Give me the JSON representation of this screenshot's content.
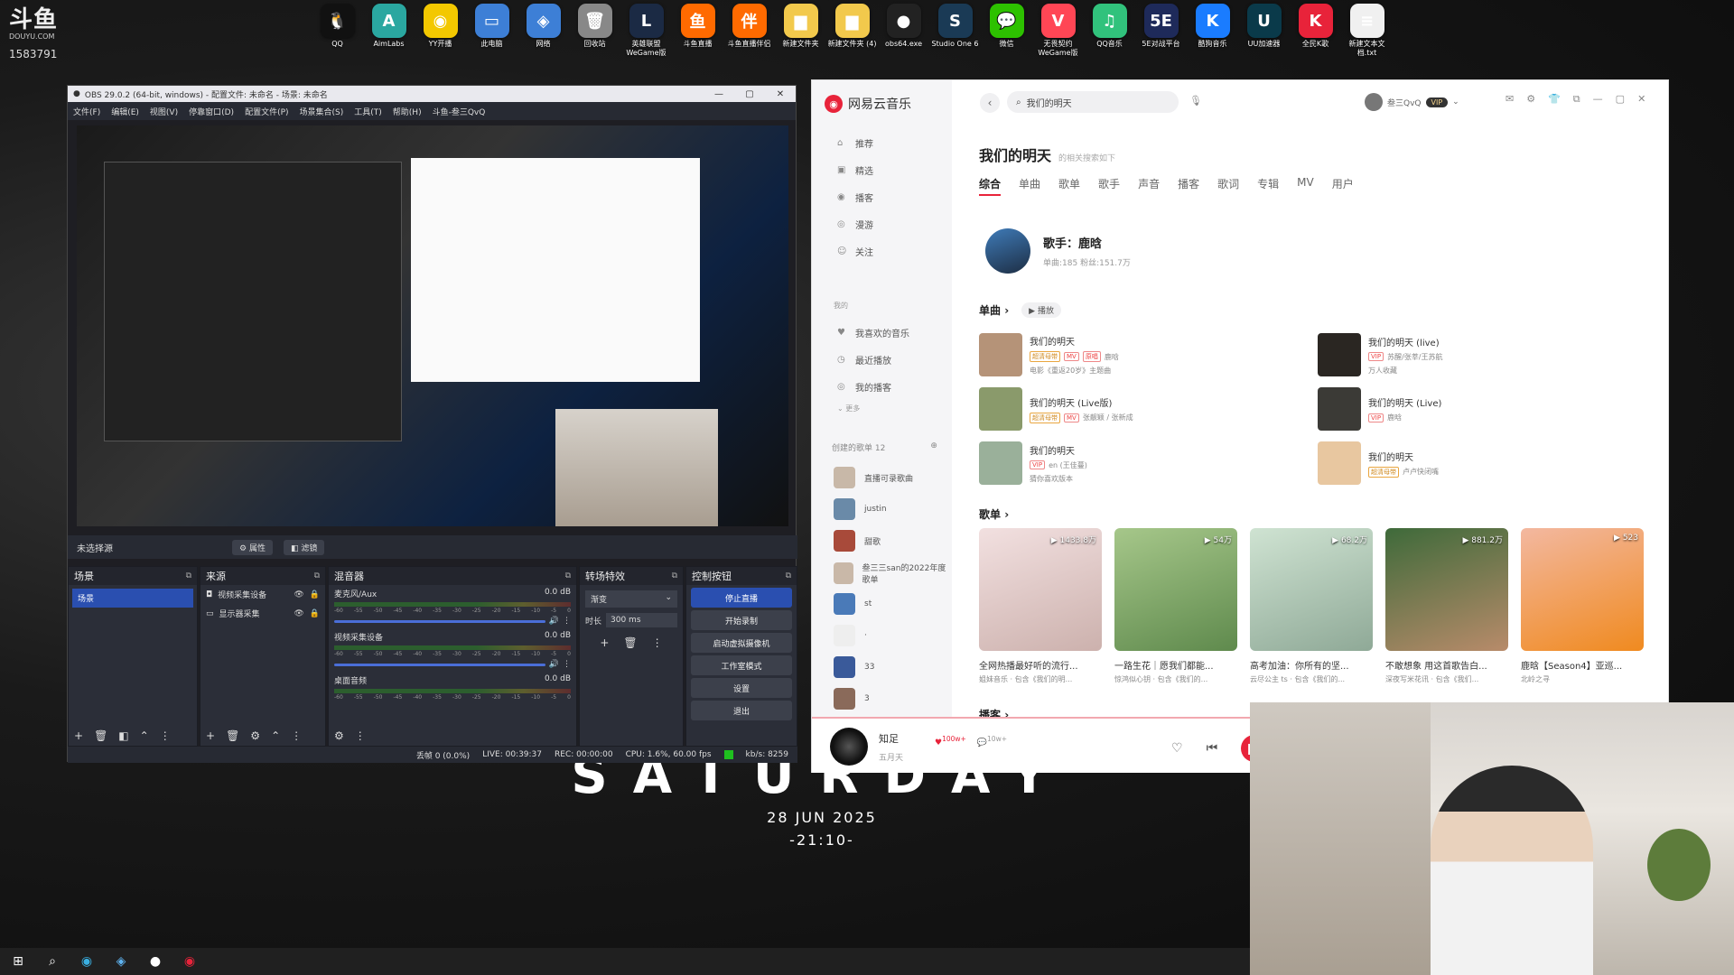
{
  "watermark": {
    "logo": "斗鱼",
    "site": "DOUYU.COM",
    "room": "1583791"
  },
  "desktop_icons": [
    {
      "label": "QQ",
      "color": "#111",
      "glyph": "🐧"
    },
    {
      "label": "AimLabs",
      "color": "#2aa7a0",
      "glyph": "A"
    },
    {
      "label": "YY开播",
      "color": "#f3c800",
      "glyph": "◉"
    },
    {
      "label": "此电脑",
      "color": "#3d7fd6",
      "glyph": "▭"
    },
    {
      "label": "网络",
      "color": "#3d7fd6",
      "glyph": "◈"
    },
    {
      "label": "回收站",
      "color": "#888",
      "glyph": "🗑"
    },
    {
      "label": "英雄联盟 WeGame版",
      "color": "#1b2a44",
      "glyph": "L"
    },
    {
      "label": "斗鱼直播",
      "color": "#ff6a00",
      "glyph": "鱼"
    },
    {
      "label": "斗鱼直播伴侣",
      "color": "#ff6a00",
      "glyph": "伴"
    },
    {
      "label": "新建文件夹",
      "color": "#f2c94c",
      "glyph": "▆"
    },
    {
      "label": "新建文件夹 (4)",
      "color": "#f2c94c",
      "glyph": "▆"
    },
    {
      "label": "obs64.exe",
      "color": "#222",
      "glyph": "●"
    },
    {
      "label": "Studio One 6",
      "color": "#1a3a55",
      "glyph": "S"
    },
    {
      "label": "微信",
      "color": "#2dc100",
      "glyph": "💬"
    },
    {
      "label": "无畏契约 WeGame版",
      "color": "#ff4655",
      "glyph": "V"
    },
    {
      "label": "QQ音乐",
      "color": "#31c27c",
      "glyph": "♫"
    },
    {
      "label": "5E对战平台",
      "color": "#1e2a5a",
      "glyph": "5E"
    },
    {
      "label": "酷狗音乐",
      "color": "#1a7cff",
      "glyph": "K"
    },
    {
      "label": "UU加速器",
      "color": "#0a3a4a",
      "glyph": "U"
    },
    {
      "label": "全民K歌",
      "color": "#e8233a",
      "glyph": "K"
    },
    {
      "label": "新建文本文档.txt",
      "color": "#f0f0f0",
      "glyph": "≡"
    }
  ],
  "wallpaper": {
    "title": "SATURDAY",
    "date": "28 JUN 2025",
    "time": "-21:10-"
  },
  "obs": {
    "title": "OBS 29.0.2 (64-bit, windows) - 配置文件: 未命名 - 场景: 未命名",
    "menu": [
      "文件(F)",
      "编辑(E)",
      "视图(V)",
      "停靠窗口(D)",
      "配置文件(P)",
      "场景集合(S)",
      "工具(T)",
      "帮助(H)",
      "斗鱼-叁三QvQ"
    ],
    "no_source": "未选择源",
    "btn_props": "属性",
    "btn_filters": "滤镜",
    "docks": {
      "scenes": "场景",
      "sources": "来源",
      "mixer": "混音器",
      "transitions": "转场特效",
      "controls": "控制按钮"
    },
    "scene_items": [
      "场景"
    ],
    "sources": [
      "视频采集设备",
      "显示器采集"
    ],
    "mixer": [
      {
        "name": "麦克风/Aux",
        "db": "0.0 dB"
      },
      {
        "name": "视频采集设备",
        "db": "0.0 dB"
      },
      {
        "name": "桌面音频",
        "db": "0.0 dB"
      }
    ],
    "mixer_ticks": [
      "-60",
      "-55",
      "-50",
      "-45",
      "-40",
      "-35",
      "-30",
      "-25",
      "-20",
      "-15",
      "-10",
      "-5",
      "0"
    ],
    "transition": {
      "type": "渐变",
      "duration_label": "时长",
      "duration": "300 ms"
    },
    "controls": [
      "停止直播",
      "开始录制",
      "启动虚拟摄像机",
      "工作室模式",
      "设置",
      "退出"
    ],
    "status": {
      "dropped": "丢帧 0 (0.0%)",
      "live": "LIVE: 00:39:37",
      "rec": "REC: 00:00:00",
      "cpu": "CPU: 1.6%, 60.00 fps",
      "kbs": "kb/s: 8259"
    }
  },
  "netease": {
    "brand": "网易云音乐",
    "search": "我们的明天",
    "user": "叁三QvQ",
    "vip": "VIP",
    "nav": [
      {
        "label": "推荐",
        "icon": "⌂"
      },
      {
        "label": "精选",
        "icon": "▣"
      },
      {
        "label": "播客",
        "icon": "◉"
      },
      {
        "label": "漫游",
        "icon": "◎"
      },
      {
        "label": "关注",
        "icon": "☺"
      }
    ],
    "my_label": "我的",
    "my": [
      {
        "label": "我喜欢的音乐",
        "icon": "♥"
      },
      {
        "label": "最近播放",
        "icon": "◷"
      },
      {
        "label": "我的播客",
        "icon": "◎"
      }
    ],
    "more": "更多",
    "created_label": "创建的歌单 12",
    "playlists": [
      {
        "label": "直播可录歌曲"
      },
      {
        "label": "justin"
      },
      {
        "label": "甜歌"
      },
      {
        "label": "叁三三san的2022年度歌单"
      },
      {
        "label": "st"
      },
      {
        "label": "·"
      },
      {
        "label": "33"
      },
      {
        "label": "3"
      }
    ],
    "result_title": "我们的明天",
    "result_hint": "的相关搜索如下",
    "tabs": [
      "综合",
      "单曲",
      "歌单",
      "歌手",
      "声音",
      "播客",
      "歌词",
      "专辑",
      "MV",
      "用户"
    ],
    "artist": {
      "label": "歌手：鹿晗",
      "meta": "单曲:185    粉丝:151.7万"
    },
    "singles_label": "单曲",
    "play_label": "播放",
    "singles": [
      {
        "title": "我们的明天",
        "tags": [
          "超清母带",
          "MV",
          "原唱"
        ],
        "sub": "鹿晗",
        "sub2": "电影《重返20岁》主题曲",
        "color": "#b59378"
      },
      {
        "title": "我们的明天 (Live版)",
        "tags": [
          "超清母带",
          "MV"
        ],
        "sub": "张靓颖 / 张新成",
        "sub2": "",
        "color": "#8a9a6b"
      },
      {
        "title": "我们的明天",
        "tags": [
          "VIP"
        ],
        "sub": "en (王佳蔓)",
        "sub2": "猜你喜欢版本",
        "color": "#9ab09a"
      },
      {
        "title": "我们的明天 (live)",
        "tags": [
          "VIP"
        ],
        "sub": "苏醒/张莘/王苏航",
        "sub2": "万人收藏",
        "color": "#2a2622"
      },
      {
        "title": "我们的明天 (Live)",
        "tags": [
          "VIP"
        ],
        "sub": "鹿晗",
        "sub2": "",
        "color": "#3b3a36"
      },
      {
        "title": "我们的明天",
        "tags": [
          "超清母带"
        ],
        "sub": "卢卢快闭嘴",
        "sub2": "",
        "color": "#e8c7a0"
      }
    ],
    "playlists_label": "歌单",
    "playlist_cards": [
      {
        "name": "全网热播最好听的流行...",
        "author": "姐妹音乐 · 包含《我们的明...",
        "count": "1433.8万",
        "c1": "#f2e0e0",
        "c2": "#ccb1ad"
      },
      {
        "name": "一路生花｜愿我们都能...",
        "author": "惊鸿似心钥 · 包含《我们的...",
        "count": "54万",
        "c1": "#a6c78a",
        "c2": "#5f8a4d"
      },
      {
        "name": "高考加油：你所有的坚...",
        "author": "云尽公主 ts · 包含《我们的...",
        "count": "68.2万",
        "c1": "#cfe3d2",
        "c2": "#8fa997"
      },
      {
        "name": "不敢想象 用这首歌告白...",
        "author": "深夜写米花讯 · 包含《我们...",
        "count": "881.2万",
        "c1": "#3e6a3a",
        "c2": "#b88b6a"
      },
      {
        "name": "鹿晗【Season4】亚巡...",
        "author": "北岭之寻",
        "count": "523",
        "c1": "#f3b8a0",
        "c2": "#f08a1f"
      }
    ],
    "podcast_label": "播客",
    "player": {
      "song": "知足",
      "artist": "五月天",
      "likes": "100w+",
      "comments": "10w+"
    }
  }
}
